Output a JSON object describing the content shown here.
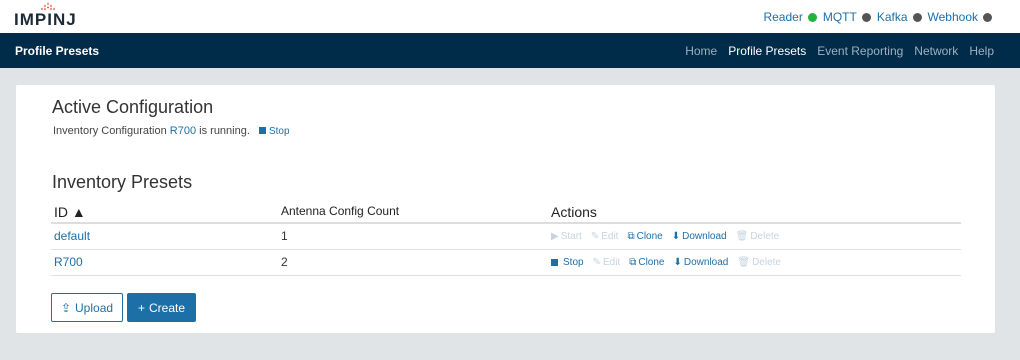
{
  "brand": {
    "logo_text": "IMPINJ"
  },
  "status": {
    "items": [
      {
        "label": "Reader",
        "color": "#22b33b"
      },
      {
        "label": "MQTT",
        "color": "#555555"
      },
      {
        "label": "Kafka",
        "color": "#555555"
      },
      {
        "label": "Webhook",
        "color": "#555555"
      }
    ]
  },
  "navbar": {
    "title": "Profile Presets",
    "menu": [
      "Home",
      "Profile Presets",
      "Event Reporting",
      "Network",
      "Help"
    ],
    "active": "Profile Presets"
  },
  "active_config": {
    "heading": "Active Configuration",
    "text_before": "Inventory Configuration",
    "preset": "R700",
    "text_after": "is running.",
    "stop_label": "Stop"
  },
  "presets": {
    "heading": "Inventory Presets",
    "columns": [
      "ID ▲",
      "Antenna Config Count",
      "Actions"
    ],
    "rows": [
      {
        "id": "default",
        "count": "1",
        "actions": [
          {
            "label": "Start",
            "icon": "play-icon",
            "enabled": false
          },
          {
            "label": "Edit",
            "icon": "pencil-icon",
            "enabled": false
          },
          {
            "label": "Clone",
            "icon": "copy-icon",
            "enabled": true
          },
          {
            "label": "Download",
            "icon": "download-icon",
            "enabled": true
          },
          {
            "label": "Delete",
            "icon": "trash-icon",
            "enabled": false
          }
        ]
      },
      {
        "id": "R700",
        "count": "2",
        "actions": [
          {
            "label": "Stop",
            "icon": "stop-icon",
            "enabled": true
          },
          {
            "label": "Edit",
            "icon": "pencil-icon",
            "enabled": false
          },
          {
            "label": "Clone",
            "icon": "copy-icon",
            "enabled": true
          },
          {
            "label": "Download",
            "icon": "download-icon",
            "enabled": true
          },
          {
            "label": "Delete",
            "icon": "trash-icon",
            "enabled": false
          }
        ]
      }
    ]
  },
  "buttons": {
    "upload": "Upload",
    "create": "Create"
  }
}
